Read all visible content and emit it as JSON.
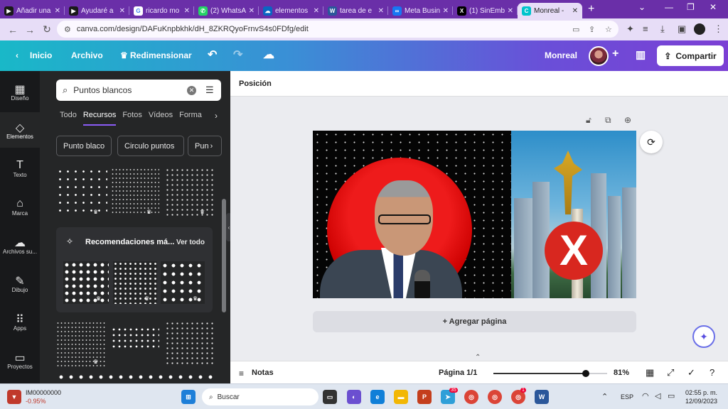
{
  "browser": {
    "tabs": [
      {
        "title": "Añadir una",
        "fav_color": "#1a1a1a",
        "fav_glyph": "▶"
      },
      {
        "title": "Ayudaré a",
        "fav_color": "#1a1a1a",
        "fav_glyph": "▶"
      },
      {
        "title": "ricardo mo",
        "fav_color": "#ffffff",
        "fav_glyph": "G"
      },
      {
        "title": "(2) WhatsA",
        "fav_color": "#25d366",
        "fav_glyph": "✆"
      },
      {
        "title": "elementos",
        "fav_color": "#0a66c2",
        "fav_glyph": "☁"
      },
      {
        "title": "tarea de e",
        "fav_color": "#2b579a",
        "fav_glyph": "W"
      },
      {
        "title": "Meta Busin",
        "fav_color": "#1877f2",
        "fav_glyph": "∞"
      },
      {
        "title": "(1) SinEmb",
        "fav_color": "#000000",
        "fav_glyph": "X"
      },
      {
        "title": "Monreal -",
        "fav_color": "#00c4cc",
        "fav_glyph": "C"
      }
    ],
    "new_tab": "+",
    "url": "canva.com/design/DAFuKnpbkhk/dH_8ZKRQyoFrnvS4s0FDfg/edit"
  },
  "canva_header": {
    "back_label": "Inicio",
    "file_label": "Archivo",
    "resize_label": "Redimensionar",
    "design_title": "Monreal",
    "share_label": "Compartir"
  },
  "rail": [
    {
      "label": "Diseño",
      "icon": "layout-icon",
      "glyph": "▦"
    },
    {
      "label": "Elementos",
      "icon": "shapes-icon",
      "glyph": "◇"
    },
    {
      "label": "Texto",
      "icon": "text-icon",
      "glyph": "T"
    },
    {
      "label": "Marca",
      "icon": "brand-icon",
      "glyph": "⌂"
    },
    {
      "label": "Archivos su...",
      "icon": "upload-icon",
      "glyph": "☁"
    },
    {
      "label": "Dibujo",
      "icon": "draw-icon",
      "glyph": "✎"
    },
    {
      "label": "Apps",
      "icon": "apps-icon",
      "glyph": "⠿"
    },
    {
      "label": "Proyectos",
      "icon": "folder-icon",
      "glyph": "▭"
    }
  ],
  "panel": {
    "search_value": "Puntos blancos",
    "tabs": [
      "Todo",
      "Recursos",
      "Fotos",
      "Vídeos",
      "Forma"
    ],
    "active_tab": "Recursos",
    "chips": [
      "Punto blaco",
      "Circulo puntos",
      "Pun"
    ],
    "recommend_title": "Recomendaciones má...",
    "see_all": "Ver todo"
  },
  "workspace": {
    "position_label": "Posición",
    "add_page": "+ Agregar página"
  },
  "bottom": {
    "notes": "Notas",
    "page": "Página 1/1",
    "zoom": "81%",
    "zoom_fraction": 0.81
  },
  "taskbar": {
    "stock_name": "IM00000000",
    "stock_change": "-0.95%",
    "search_label": "Buscar",
    "lang": "ESP",
    "time": "02:55 p. m.",
    "date": "12/09/2023",
    "badge_1": "35",
    "badge_2": "1"
  }
}
